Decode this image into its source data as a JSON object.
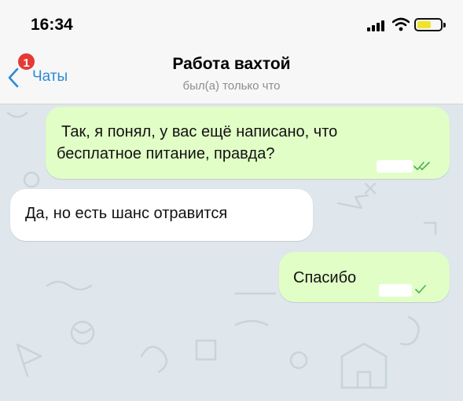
{
  "status_bar": {
    "time": "16:34"
  },
  "nav": {
    "back_label": "Чаты",
    "unread_badge": "1",
    "title": "Работа вахтой",
    "subtitle": "был(а) только что"
  },
  "messages": [
    {
      "direction": "outgoing",
      "text_line1": "Так, я понял, у вас ещё написано, что",
      "text_line2": "бесплатное питание, правда?",
      "status": "read"
    },
    {
      "direction": "incoming",
      "text": "Да, но есть шанс отравится"
    },
    {
      "direction": "outgoing",
      "text": "Спасибо",
      "status": "delivered"
    }
  ],
  "colors": {
    "outgoing_bubble": "#e1fec6",
    "incoming_bubble": "#ffffff",
    "accent": "#2a8bd6",
    "badge": "#e53935",
    "check": "#4caf50"
  }
}
